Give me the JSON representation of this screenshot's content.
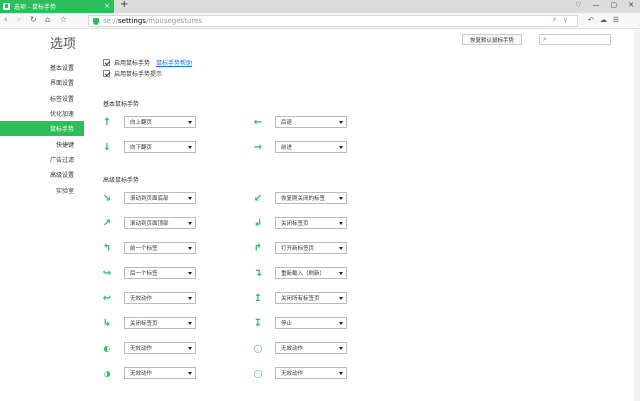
{
  "tab": {
    "title": "选项 - 鼠标手势",
    "close": "×",
    "new": "+"
  },
  "window": {
    "btn1": "♡",
    "btn2": "—",
    "btn3": "▢",
    "btn4": "✕"
  },
  "address": {
    "proto": "se://",
    "host": "settings",
    "path": "/mousegestures"
  },
  "toolbar": {
    "bolt": "⚡",
    "dropdown": "∨",
    "undo": "↶",
    "cloud": "☁",
    "menu": "☰"
  },
  "page": {
    "title": "选项",
    "reset_label": "恢复默认鼠标手势",
    "search_placeholder": ""
  },
  "sidebar": {
    "items": [
      {
        "label": "基本设置"
      },
      {
        "label": "界面设置"
      },
      {
        "label": "标签设置"
      },
      {
        "label": "优化加速"
      },
      {
        "label": "鼠标手势"
      },
      {
        "label": "快捷键"
      },
      {
        "label": "广告过滤"
      },
      {
        "label": "高级设置"
      },
      {
        "label": "实验室"
      }
    ]
  },
  "options": {
    "enable": "启用鼠标手势",
    "help": "鼠标手势帮助",
    "hint": "启用鼠标手势提示"
  },
  "sections": {
    "basic": "基本鼠标手势",
    "advanced": "高级鼠标手势"
  },
  "gestures": {
    "basic": [
      {
        "arrow": "↑",
        "value": "向上翻页"
      },
      {
        "arrow": "←",
        "value": "后退"
      },
      {
        "arrow": "↓",
        "value": "向下翻页"
      },
      {
        "arrow": "→",
        "value": "前进"
      }
    ],
    "advanced": [
      {
        "arrow": "↘",
        "value": "滚动到页面底部"
      },
      {
        "arrow": "↙",
        "value": "恢复刚关闭的标签"
      },
      {
        "arrow": "↗",
        "value": "滚动到页面顶部"
      },
      {
        "arrow": "↲",
        "value": "关闭标签页"
      },
      {
        "arrow": "↰",
        "value": "前一个标签"
      },
      {
        "arrow": "↱",
        "value": "打开新标签页"
      },
      {
        "arrow": "↪",
        "value": "后一个标签"
      },
      {
        "arrow": "↴",
        "value": "重新载入（刷新）"
      },
      {
        "arrow": "↩",
        "value": "无效动作"
      },
      {
        "arrow": "↥",
        "value": "关闭所有标签页"
      },
      {
        "arrow": "↳",
        "value": "关闭标签页"
      },
      {
        "arrow": "↧",
        "value": "停止"
      },
      {
        "arrow": "◐",
        "value": "无效动作"
      },
      {
        "arrow": "◯",
        "value": "无效动作"
      },
      {
        "arrow": "◑",
        "value": "无效动作"
      },
      {
        "arrow": "◯",
        "value": "无效动作"
      }
    ]
  },
  "colors": {
    "accent": "#2dbd5a"
  }
}
